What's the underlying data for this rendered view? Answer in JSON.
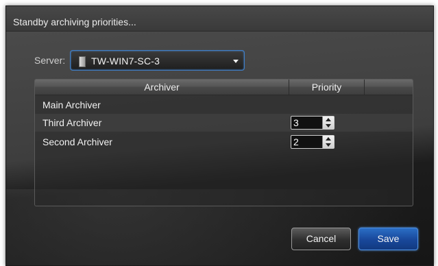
{
  "dialog": {
    "title": "Standby archiving priorities..."
  },
  "server": {
    "label": "Server:",
    "value": "TW-WIN7-SC-3",
    "icon": "server-icon"
  },
  "table": {
    "columns": [
      "Archiver",
      "Priority"
    ],
    "rows": [
      {
        "name": "Main Archiver",
        "priority": null
      },
      {
        "name": "Third Archiver",
        "priority": "3"
      },
      {
        "name": "Second Archiver",
        "priority": "2"
      }
    ]
  },
  "buttons": {
    "cancel": "Cancel",
    "save": "Save"
  },
  "colors": {
    "accent": "#2b6ec5",
    "focus_border": "#3f7fc9"
  }
}
